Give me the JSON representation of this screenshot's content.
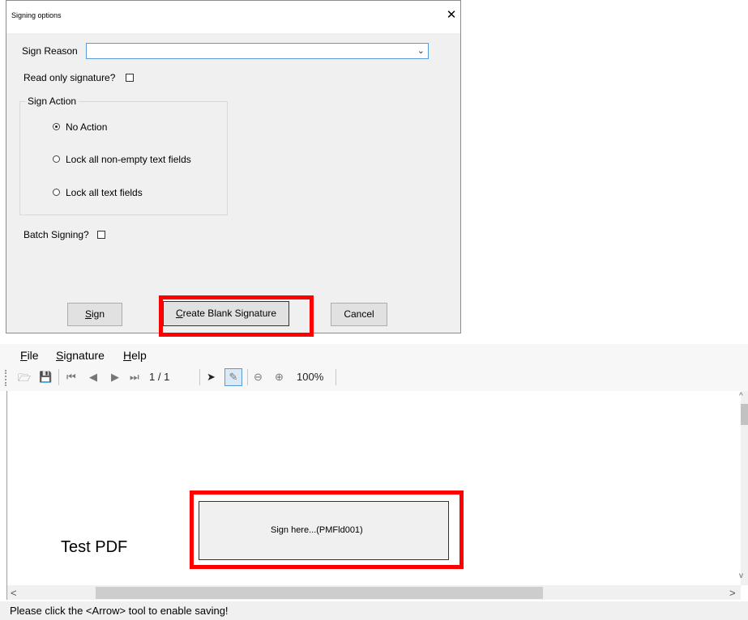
{
  "dialog": {
    "title": "Signing options",
    "close_glyph": "✕",
    "sign_reason_label": "Sign Reason",
    "sign_reason_value": "",
    "dropdown_glyph": "⌄",
    "read_only_label": "Read only signature?",
    "read_only_checked": false,
    "sign_action_legend": "Sign Action",
    "sign_action_options": [
      {
        "label": "No Action",
        "selected": true
      },
      {
        "label": "Lock all non-empty text fields",
        "selected": false
      },
      {
        "label": "Lock all text fields",
        "selected": false
      }
    ],
    "batch_label": "Batch Signing?",
    "batch_checked": false,
    "buttons": {
      "sign_mnemonic": "S",
      "sign_rest": "ign",
      "blank_mnemonic": "C",
      "blank_rest": "reate Blank Signature",
      "cancel": "Cancel"
    }
  },
  "viewer": {
    "menu": [
      {
        "mnemonic": "F",
        "rest": "ile"
      },
      {
        "mnemonic": "S",
        "rest": "ignature"
      },
      {
        "mnemonic": "H",
        "rest": "elp"
      }
    ],
    "toolbar": {
      "open_icon": "🗁",
      "save_icon": "💾",
      "first_icon": "⏮",
      "prev_icon": "◀",
      "next_icon": "▶",
      "last_icon": "⏭",
      "page_indicator": "1 / 1",
      "arrow_icon": "➤",
      "sign_tool_icon": "✎",
      "zoom_out_icon": "⊖",
      "zoom_in_icon": "⊕",
      "zoom_level": "100%"
    },
    "document": {
      "title": "Test PDF",
      "signature_field_text": "Sign here...(PMFld001)"
    },
    "scroll_glyphs": {
      "left": "<",
      "right": ">",
      "up": "^",
      "down": "v"
    },
    "status": "Please click the <Arrow> tool to enable saving!"
  },
  "colors": {
    "highlight": "#ff0000",
    "dialog_bg": "#f0f0f0",
    "input_focus_border": "#5a9ad8"
  }
}
